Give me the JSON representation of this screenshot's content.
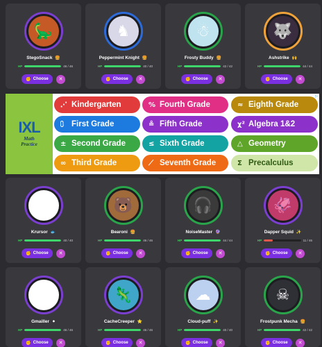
{
  "choose_label": "Choose",
  "ad": {
    "logo": "IXL",
    "tagline_1": "Math",
    "tagline_2": "Practice",
    "info": "▷",
    "grades": [
      {
        "label": "Kindergarten",
        "icon": "⋰",
        "color": "#e13b3b"
      },
      {
        "label": "Fourth Grade",
        "icon": "%",
        "color": "#e12f86"
      },
      {
        "label": "Eighth Grade",
        "icon": "≈",
        "color": "#b8890c"
      },
      {
        "label": "First Grade",
        "icon": "⩇",
        "color": "#1d7be0"
      },
      {
        "label": "Fifth Grade",
        "icon": "≗",
        "color": "#8c31c9"
      },
      {
        "label": "Algebra 1&2",
        "icon": "χ²",
        "color": "#8c31c9"
      },
      {
        "label": "Second Grade",
        "icon": "±",
        "color": "#3aa845"
      },
      {
        "label": "Sixth Grade",
        "icon": "≤",
        "color": "#14a3a3"
      },
      {
        "label": "Geometry",
        "icon": "△",
        "color": "#5ea52a"
      },
      {
        "label": "Third Grade",
        "icon": "∞",
        "color": "#ee9b12"
      },
      {
        "label": "Seventh Grade",
        "icon": "⟋",
        "color": "#ef6a14"
      },
      {
        "label": "Precalculus",
        "icon": "Σ",
        "color": "#cfe6a8",
        "text_color": "#2e5a12"
      }
    ]
  },
  "monsters": [
    {
      "name": "StegoSnack",
      "badge": "🍔",
      "hp": "46 / 46",
      "hp_frac": 1.0,
      "avatar_color": "#c65a26",
      "avatar_glyph": "🦕",
      "ring": "#7b3fcf"
    },
    {
      "name": "Peppermint Knight",
      "badge": "🍔",
      "hp": "40 / 40",
      "hp_frac": 1.0,
      "avatar_color": "#d8d8e8",
      "avatar_glyph": "♞",
      "ring": "#2d6bd8"
    },
    {
      "name": "Frosty Buddy",
      "badge": "🍔",
      "hp": "42 / 42",
      "hp_frac": 1.0,
      "avatar_color": "#bfe3ef",
      "avatar_glyph": "☃",
      "ring": "#2aa44a"
    },
    {
      "name": "Ashstrike",
      "badge": "🙌",
      "hp": "44 / 44",
      "hp_frac": 1.0,
      "avatar_color": "#3a2d3f",
      "avatar_glyph": "🐺",
      "ring": "#f0a23a"
    },
    {
      "name": "Krursor",
      "badge": "🐟",
      "hp": "40 / 40",
      "hp_frac": 1.0,
      "avatar_color": "#ffffff",
      "avatar_glyph": "➤",
      "ring": "#7b3fcf"
    },
    {
      "name": "Bearoni",
      "badge": "🍔",
      "hp": "46 / 46",
      "hp_frac": 1.0,
      "avatar_color": "#a06a3a",
      "avatar_glyph": "🐻",
      "ring": "#2aa44a"
    },
    {
      "name": "NoiseMaster",
      "badge": "🔮",
      "hp": "44 / 44",
      "hp_frac": 1.0,
      "avatar_color": "#3a3a3a",
      "avatar_glyph": "🎧",
      "ring": "#2aa44a"
    },
    {
      "name": "Dapper Squid",
      "badge": "✨",
      "hp": "11 / 46",
      "hp_frac": 0.24,
      "avatar_color": "#c03a6a",
      "avatar_glyph": "🦑",
      "ring": "#7b3fcf"
    },
    {
      "name": "Gmailler",
      "badge": "⚫",
      "hp": "46 / 46",
      "hp_frac": 1.0,
      "avatar_color": "#ffffff",
      "avatar_glyph": "✉",
      "ring": "#7b3fcf"
    },
    {
      "name": "CacheCreeper",
      "badge": "⭐",
      "hp": "46 / 46",
      "hp_frac": 1.0,
      "avatar_color": "#3fa6c9",
      "avatar_glyph": "🦎",
      "ring": "#7b3fcf"
    },
    {
      "name": "Cloud-puff",
      "badge": "✨",
      "hp": "40 / 40",
      "hp_frac": 1.0,
      "avatar_color": "#bcd0f0",
      "avatar_glyph": "☁",
      "ring": "#2aa44a"
    },
    {
      "name": "Frostpunk Mecha",
      "badge": "🍔",
      "hp": "42 / 42",
      "hp_frac": 1.0,
      "avatar_color": "#2f2f36",
      "avatar_glyph": "☠",
      "ring": "#2aa44a"
    }
  ]
}
